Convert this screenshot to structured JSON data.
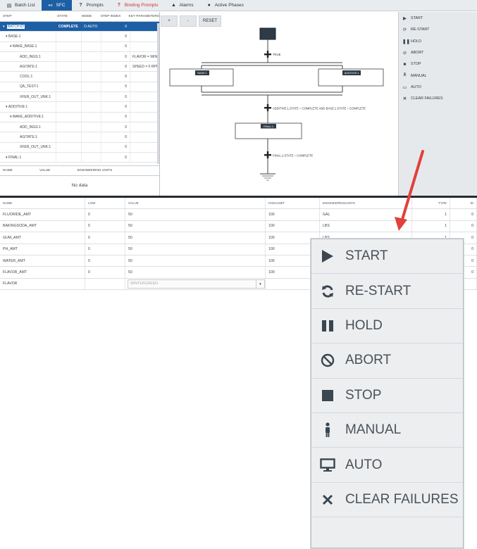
{
  "tabs": [
    {
      "label": "Batch List",
      "icon": "list-icon"
    },
    {
      "label": "SFC",
      "icon": "sfc-icon",
      "active": true
    },
    {
      "label": "Prompts",
      "icon": "question-icon"
    },
    {
      "label": "Binding Prompts",
      "icon": "question-icon",
      "warning": true
    },
    {
      "label": "Alarms",
      "icon": "bell-icon"
    },
    {
      "label": "Active Phases",
      "icon": "person-icon"
    }
  ],
  "tree": {
    "headers": {
      "step": "STEP",
      "state": "STATE",
      "mode": "MODE",
      "step_index": "STEP INDEX",
      "key_params": "KEY PARAMETERS"
    },
    "rows": [
      {
        "step": "BATCH:ID",
        "state": "COMPLETE",
        "mode": "O-AUTO",
        "index": "0",
        "key": ""
      },
      {
        "step": "BASE:1",
        "state": "",
        "mode": "",
        "index": "0",
        "key": ""
      },
      {
        "step": "MAKE_BASE:1",
        "state": "",
        "mode": "",
        "index": "0",
        "key": ""
      },
      {
        "step": "ADD_INGS:1",
        "state": "",
        "mode": "",
        "index": "0",
        "key": "FLAVOR = WIN"
      },
      {
        "step": "AGITATE:1",
        "state": "",
        "mode": "",
        "index": "0",
        "key": "SPEED = 0 RPM"
      },
      {
        "step": "COOL:1",
        "state": "",
        "mode": "",
        "index": "0",
        "key": ""
      },
      {
        "step": "QA_TEST:1",
        "state": "",
        "mode": "",
        "index": "0",
        "key": ""
      },
      {
        "step": "XFER_OUT_UNK:1",
        "state": "",
        "mode": "",
        "index": "0",
        "key": ""
      },
      {
        "step": "ADDITIVE:1",
        "state": "",
        "mode": "",
        "index": "0",
        "key": ""
      },
      {
        "step": "MAKE_ADDITIVE:1",
        "state": "",
        "mode": "",
        "index": "0",
        "key": ""
      },
      {
        "step": "ADD_INGS:1",
        "state": "",
        "mode": "",
        "index": "0",
        "key": ""
      },
      {
        "step": "AGITATE:1",
        "state": "",
        "mode": "",
        "index": "0",
        "key": ""
      },
      {
        "step": "XFER_OUT_UNK:1",
        "state": "",
        "mode": "",
        "index": "0",
        "key": ""
      },
      {
        "step": "FINAL:1",
        "state": "",
        "mode": "",
        "index": "0",
        "key": ""
      }
    ]
  },
  "params_table": {
    "headers": {
      "name": "NAME",
      "value": "VALUE",
      "eng_units": "ENGINEERING UNITS"
    },
    "empty_text": "No data"
  },
  "sfc": {
    "buttons": [
      "+",
      "-",
      "RESET"
    ],
    "transition_true": "TRUE",
    "step_base": "BASE:1",
    "step_additive": "ADDITIVE:1",
    "transition_complete": "ADDITIVE:1.STATE = COMPLETE AND BASE:1.STATE = COMPLETE",
    "step_final": "FINAL:1",
    "transition_final": "FINAL:1.STATE = COMPLETE"
  },
  "commands": [
    {
      "label": "START",
      "icon": "play-icon"
    },
    {
      "label": "RE-START",
      "icon": "restart-icon"
    },
    {
      "label": "HOLD",
      "icon": "pause-icon"
    },
    {
      "label": "ABORT",
      "icon": "abort-icon"
    },
    {
      "label": "STOP",
      "icon": "stop-icon"
    },
    {
      "label": "MANUAL",
      "icon": "manual-person-icon"
    },
    {
      "label": "AUTO",
      "icon": "monitor-icon"
    },
    {
      "label": "CLEAR FAILURES",
      "icon": "x-icon"
    }
  ],
  "formula": {
    "headers": {
      "name": "NAME",
      "low": "LOW",
      "value": "VALUE",
      "high": "HIGHLIMIT",
      "eng": "ENGINEERINGUNITS",
      "type": "TYPE",
      "id": "ID"
    },
    "rows": [
      {
        "name": "FLUORIDE_AMT",
        "low": "0",
        "value": "50",
        "high": "100",
        "eng": "GAL",
        "type": "1",
        "id": "0"
      },
      {
        "name": "BAKINGSODA_AMT",
        "low": "0",
        "value": "50",
        "high": "100",
        "eng": "LBS",
        "type": "1",
        "id": "0"
      },
      {
        "name": "GUM_AMT",
        "low": "0",
        "value": "50",
        "high": "100",
        "eng": "LBS",
        "type": "1",
        "id": "0"
      },
      {
        "name": "PH_AMT",
        "low": "0",
        "value": "50",
        "high": "100",
        "eng": "",
        "type": "",
        "id": "0"
      },
      {
        "name": "WATER_AMT",
        "low": "0",
        "value": "50",
        "high": "100",
        "eng": "",
        "type": "",
        "id": "0"
      },
      {
        "name": "FLAVOR_AMT",
        "low": "0",
        "value": "50",
        "high": "100",
        "eng": "",
        "type": "",
        "id": "0"
      }
    ],
    "flavor_row": {
      "name": "FLAVOR",
      "value": "WINTERGREEN"
    }
  },
  "colors": {
    "accent": "#1d5fa4",
    "warning": "#cc3333",
    "arrow": "#e2403a",
    "panel": "#e6e9ec"
  }
}
